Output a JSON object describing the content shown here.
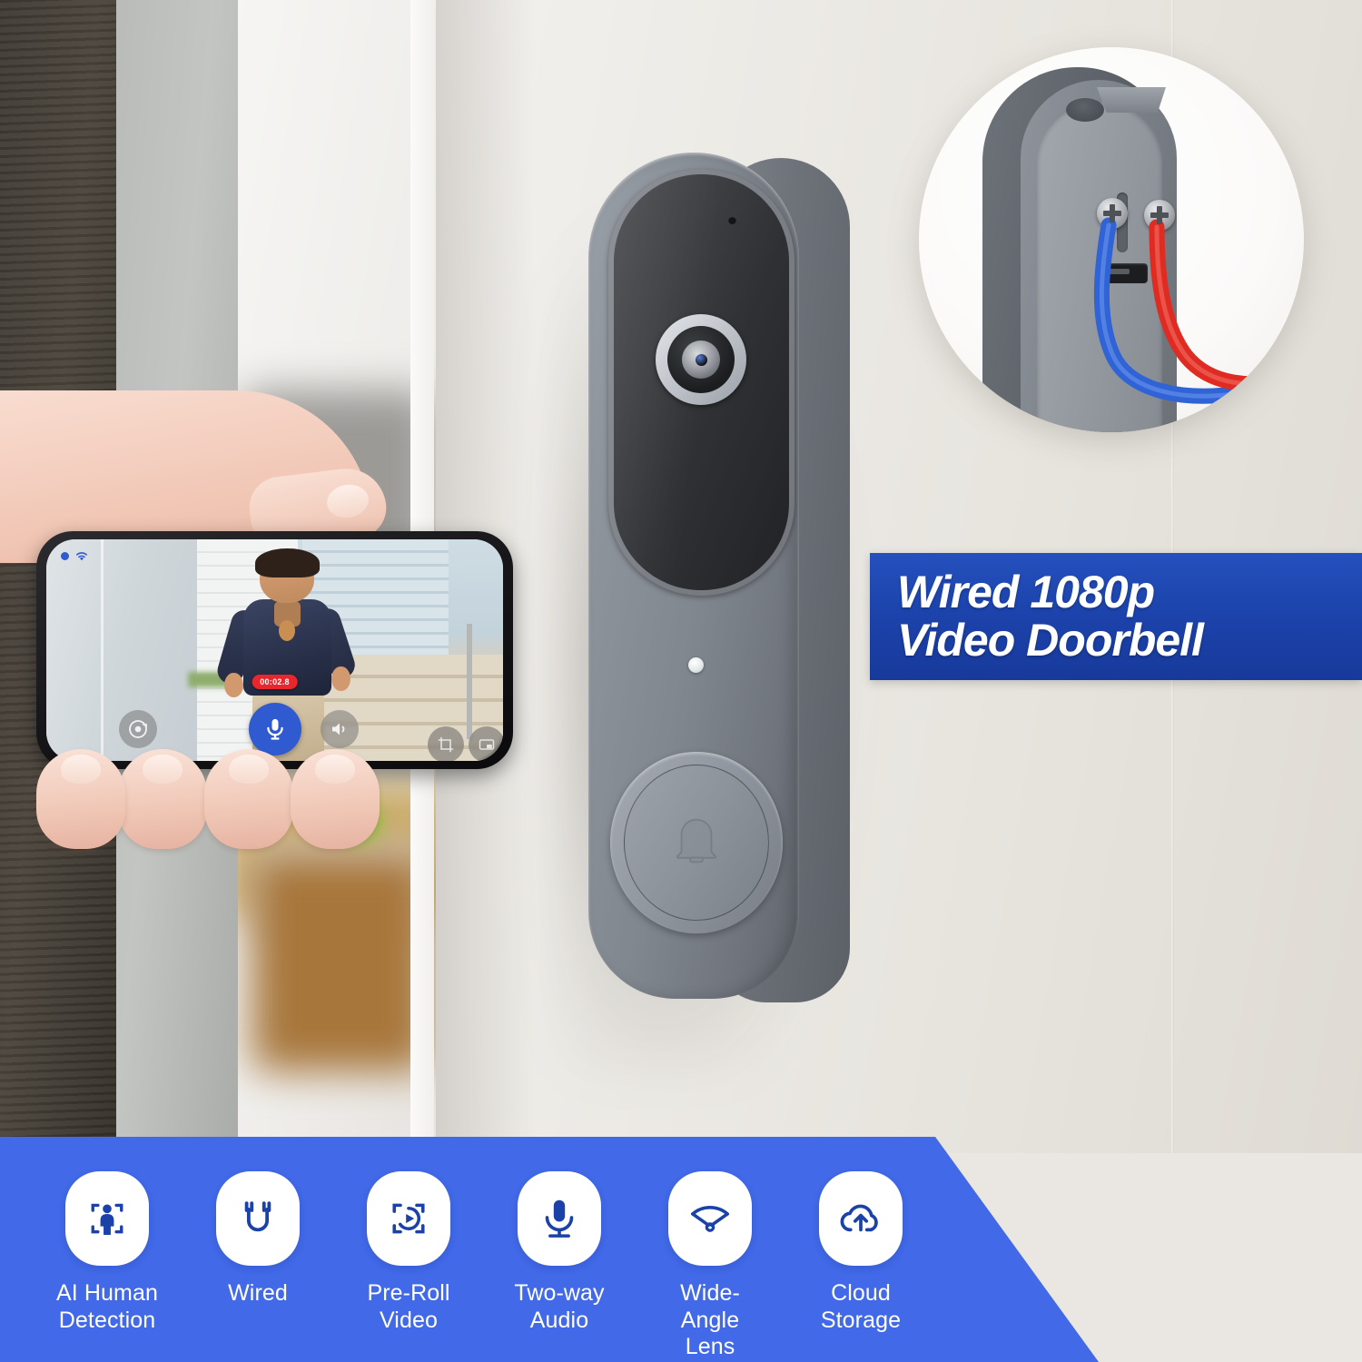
{
  "banner": {
    "line1": "Wired 1080p",
    "line2": "Video Doorbell",
    "background_color": "#1d45ae",
    "text_color": "#ffffff"
  },
  "device": {
    "name": "video-doorbell",
    "body_color": "#8d939b",
    "lens_label": "camera-lens",
    "button_icon": "bell-icon",
    "led_label": "status-led",
    "mic_label": "microphone-hole"
  },
  "inset": {
    "name": "wiring-detail-circle",
    "wire_blue_color": "#2f63d6",
    "wire_red_color": "#e02b22",
    "screw_count": 2,
    "bracket_color": "#8f949b"
  },
  "phone": {
    "status": {
      "wifi_icon": "wifi-icon",
      "live_dot": "live-indicator-dot"
    },
    "recording_timer": "00:02.8",
    "controls": [
      {
        "name": "snapshot-button",
        "icon": "camera-rotate-icon"
      },
      {
        "name": "talk-button",
        "icon": "microphone-icon",
        "active": true,
        "color": "#2f5ad0"
      },
      {
        "name": "speaker-button",
        "icon": "speaker-icon"
      },
      {
        "name": "crop-button",
        "icon": "crop-icon"
      },
      {
        "name": "fullscreen-button",
        "icon": "screen-expand-icon"
      }
    ]
  },
  "features": {
    "background_color": "#4169e8",
    "items": [
      {
        "label": "AI Human\nDetection",
        "icon": "person-detection-icon"
      },
      {
        "label": "Wired",
        "icon": "wired-plug-icon"
      },
      {
        "label": "Pre-Roll\nVideo",
        "icon": "preroll-play-icon"
      },
      {
        "label": "Two-way\nAudio",
        "icon": "microphone-icon"
      },
      {
        "label": "Wide-Angle\nLens",
        "icon": "wide-angle-icon"
      },
      {
        "label": "Cloud\nStorage",
        "icon": "cloud-upload-icon"
      }
    ]
  },
  "scene": {
    "wall_color": "#eae7e2",
    "doorframe_color": "#443e36",
    "panel_color": "#b9bbb9"
  }
}
